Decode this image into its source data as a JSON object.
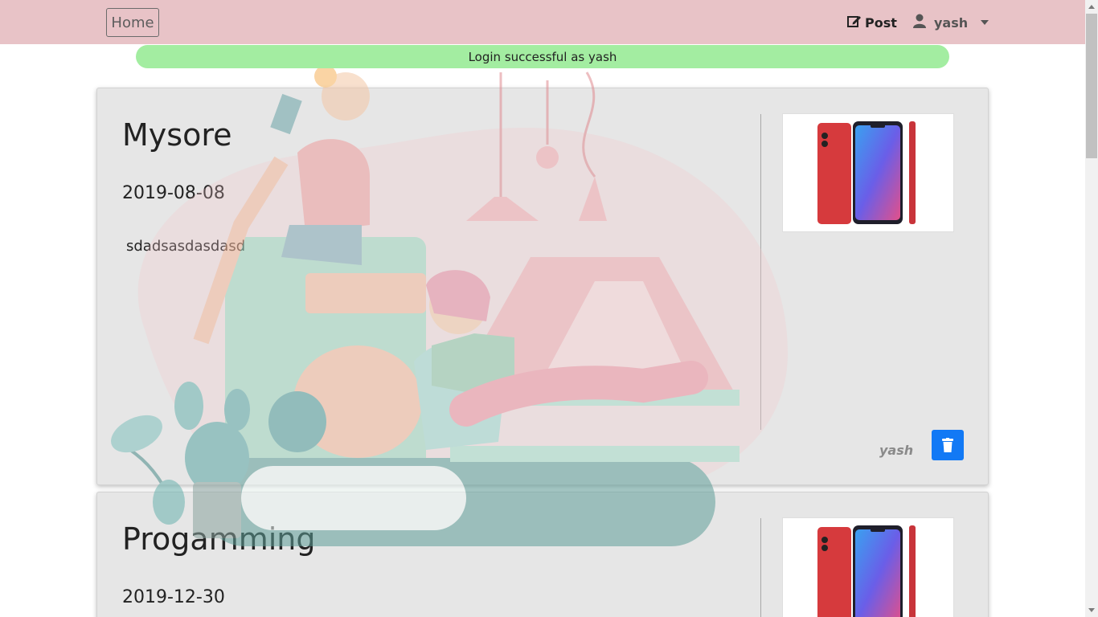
{
  "navbar": {
    "home_label": "Home",
    "post_label": "Post",
    "user_label": "yash"
  },
  "alert": {
    "message": "Login successful as yash"
  },
  "posts": [
    {
      "title": "Mysore",
      "date": "2019-08-08",
      "description": "sdadsasdasdasd",
      "author": "yash"
    },
    {
      "title": "Progamming",
      "date": "2019-12-30"
    }
  ],
  "colors": {
    "navbar": "#e8c3c7",
    "alert": "#a3eda1",
    "delete_button": "#1279f5",
    "card": "#e6e6e6"
  },
  "icons": {
    "post": "edit-icon",
    "user": "user-icon",
    "delete": "trash-icon"
  }
}
